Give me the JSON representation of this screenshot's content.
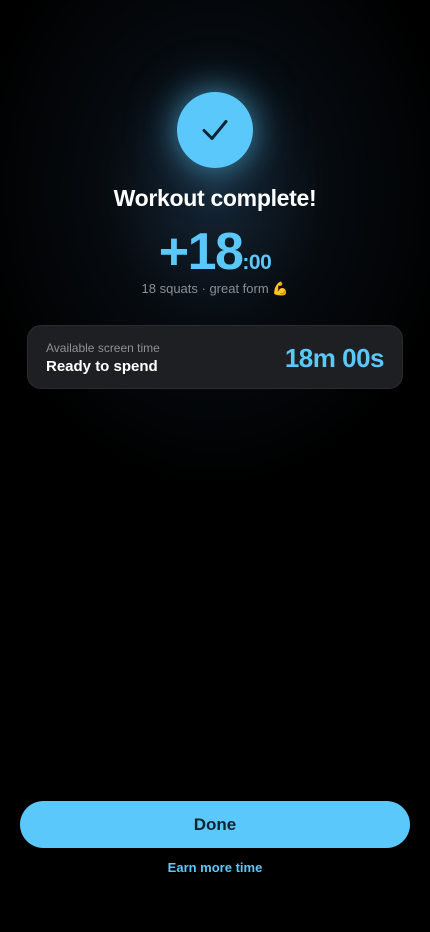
{
  "header": {
    "check_icon": "checkmark-icon",
    "title": "Workout complete!"
  },
  "earned": {
    "main": "+18",
    "suffix": ":00",
    "summary": "18 squats · great form 💪"
  },
  "screen_time_card": {
    "label": "Available screen time",
    "status": "Ready to spend",
    "value": "18m 00s"
  },
  "actions": {
    "done_label": "Done",
    "earn_more_label": "Earn more time"
  },
  "colors": {
    "accent": "#5ac8fa",
    "background": "#000000",
    "card": "#1e1f22",
    "button_text": "#0f2433"
  }
}
